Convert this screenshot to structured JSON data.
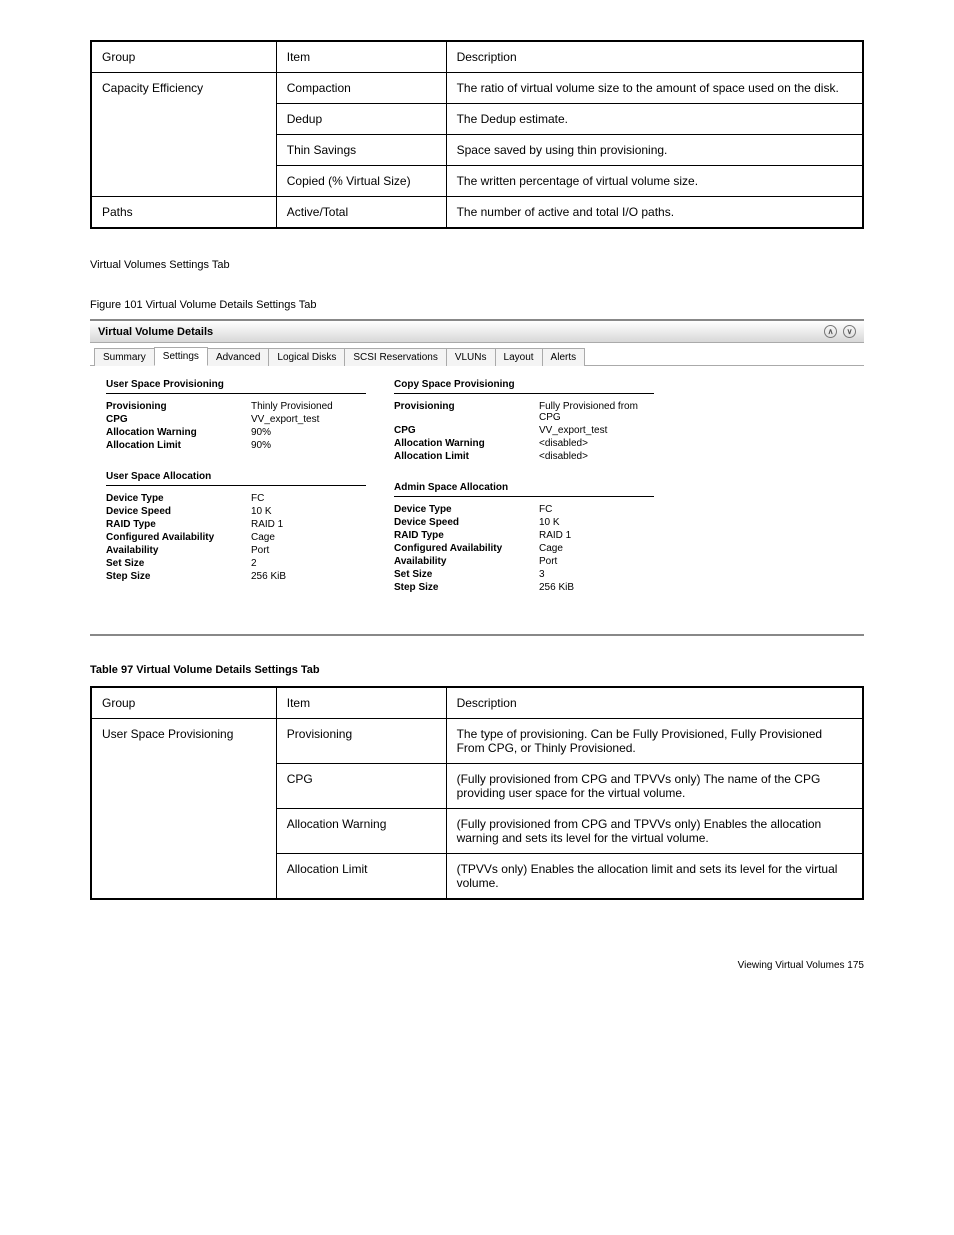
{
  "table1": {
    "headers": [
      "Group",
      "Item",
      "Description"
    ],
    "rows": [
      {
        "group": "Capacity Efficiency",
        "items": [
          {
            "item": "Compaction",
            "desc": "The ratio of virtual volume size to the amount of space used on the disk."
          },
          {
            "item": "Dedup",
            "desc": "The Dedup estimate."
          },
          {
            "item": "Thin Savings",
            "desc": "Space saved by using thin provisioning."
          },
          {
            "item": "Copied (% Virtual Size)",
            "desc": "The written percentage of virtual volume size."
          }
        ]
      },
      {
        "group": "Paths",
        "items": [
          {
            "item": "Active/Total",
            "desc": "The number of active and total I/O paths."
          }
        ]
      }
    ]
  },
  "settings_header": "Virtual Volumes Settings Tab",
  "figure_label": "Figure 101 Virtual Volume Details Settings Tab",
  "panel_title": "Virtual Volume Details",
  "tabs": [
    "Summary",
    "Settings",
    "Advanced",
    "Logical Disks",
    "SCSI Reservations",
    "VLUNs",
    "Layout",
    "Alerts"
  ],
  "active_tab": 1,
  "left_provisioning": {
    "title": "User Space Provisioning",
    "rows": [
      {
        "k": "Provisioning",
        "v": "Thinly Provisioned"
      },
      {
        "k": "CPG",
        "v": "VV_export_test"
      },
      {
        "k": "Allocation Warning",
        "v": "90%"
      },
      {
        "k": "Allocation Limit",
        "v": "90%"
      }
    ]
  },
  "right_provisioning": {
    "title": "Copy Space Provisioning",
    "rows": [
      {
        "k": "Provisioning",
        "v": "Fully Provisioned from CPG"
      },
      {
        "k": "CPG",
        "v": "VV_export_test"
      },
      {
        "k": "Allocation Warning",
        "v": "<disabled>"
      },
      {
        "k": "Allocation Limit",
        "v": "<disabled>"
      }
    ]
  },
  "left_allocation": {
    "title": "User Space Allocation",
    "rows": [
      {
        "k": "Device Type",
        "v": "FC"
      },
      {
        "k": "Device Speed",
        "v": "10 K"
      },
      {
        "k": "RAID Type",
        "v": "RAID 1"
      },
      {
        "k": "Configured Availability",
        "v": "Cage"
      },
      {
        "k": "Availability",
        "v": "Port"
      },
      {
        "k": "Set Size",
        "v": "2"
      },
      {
        "k": "Step Size",
        "v": "256 KiB"
      }
    ]
  },
  "right_allocation": {
    "title": "Admin Space Allocation",
    "rows": [
      {
        "k": "Device Type",
        "v": "FC"
      },
      {
        "k": "Device Speed",
        "v": "10 K"
      },
      {
        "k": "RAID Type",
        "v": "RAID 1"
      },
      {
        "k": "Configured Availability",
        "v": "Cage"
      },
      {
        "k": "Availability",
        "v": "Port"
      },
      {
        "k": "Set Size",
        "v": "3"
      },
      {
        "k": "Step Size",
        "v": "256 KiB"
      }
    ]
  },
  "table2_intro": "Table 97 Virtual Volume Details Settings Tab",
  "table2": {
    "headers": [
      "Group",
      "Item",
      "Description"
    ],
    "rows": [
      {
        "group": "User Space Provisioning",
        "items": [
          {
            "item": "Provisioning",
            "desc": "The type of provisioning. Can be Fully Provisioned, Fully Provisioned From CPG, or Thinly Provisioned."
          },
          {
            "item": "CPG",
            "desc": "(Fully provisioned from CPG and TPVVs only) The name of the CPG providing user space for the virtual volume."
          },
          {
            "item": "Allocation Warning",
            "desc": "(Fully provisioned from CPG and TPVVs only) Enables the allocation warning and sets its level for the virtual volume."
          },
          {
            "item": "Allocation Limit",
            "desc": "(TPVVs only) Enables the allocation limit and sets its level for the virtual volume."
          }
        ]
      }
    ]
  },
  "footer": "Viewing Virtual Volumes   175"
}
